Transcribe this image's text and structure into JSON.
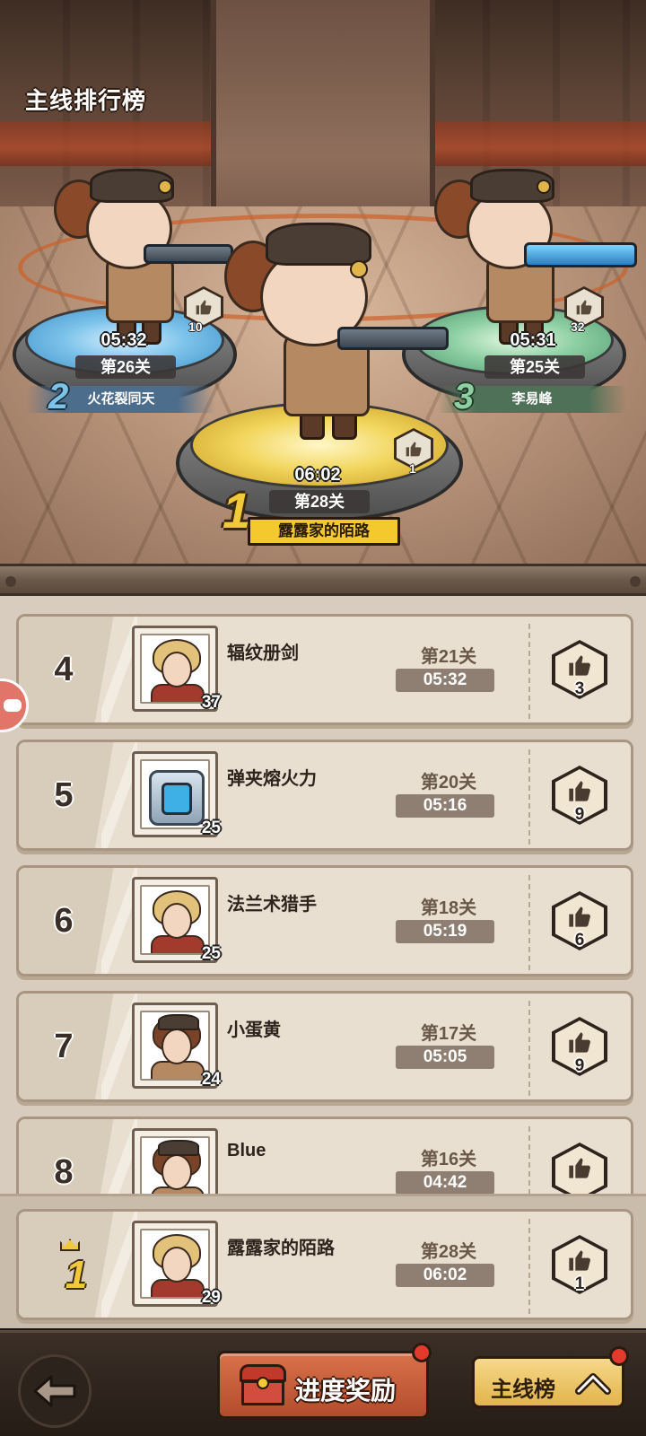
{
  "page": {
    "title": "主线排行榜"
  },
  "podium": [
    {
      "rank": "2",
      "time": "05:32",
      "level": "第26关",
      "name": "火花裂同天",
      "likes": "10"
    },
    {
      "rank": "1",
      "time": "06:02",
      "level": "第28关",
      "name": "露露家的陌路",
      "likes": "1"
    },
    {
      "rank": "3",
      "time": "05:31",
      "level": "第25关",
      "name": "李易峰",
      "likes": "32"
    }
  ],
  "list": [
    {
      "rank": "4",
      "name": "辐纹册剑",
      "avatar_level": "37",
      "stage": "第21关",
      "time": "05:32",
      "likes": "3",
      "avatar": "blond-hero"
    },
    {
      "rank": "5",
      "name": "弹夹熔火力",
      "avatar_level": "25",
      "stage": "第20关",
      "time": "05:16",
      "likes": "9",
      "avatar": "mech"
    },
    {
      "rank": "6",
      "name": "法兰术猎手",
      "avatar_level": "25",
      "stage": "第18关",
      "time": "05:19",
      "likes": "6",
      "avatar": "blond-hero"
    },
    {
      "rank": "7",
      "name": "小蛋黄",
      "avatar_level": "24",
      "stage": "第17关",
      "time": "05:05",
      "likes": "9",
      "avatar": "soldier-girl"
    },
    {
      "rank": "8",
      "name": "Blue",
      "avatar_level": "",
      "stage": "第16关",
      "time": "04:42",
      "likes": "",
      "avatar": "soldier-girl"
    }
  ],
  "self": {
    "rank": "1",
    "name": "露露家的陌路",
    "avatar_level": "29",
    "stage": "第28关",
    "time": "06:02",
    "likes": "1"
  },
  "bottom": {
    "progress_label": "进度奖励",
    "mainline_label": "主线榜"
  },
  "colors": {
    "accent_orange": "#c95d3a",
    "gold": "#f2c93a",
    "red_dot": "#e23b2e"
  }
}
